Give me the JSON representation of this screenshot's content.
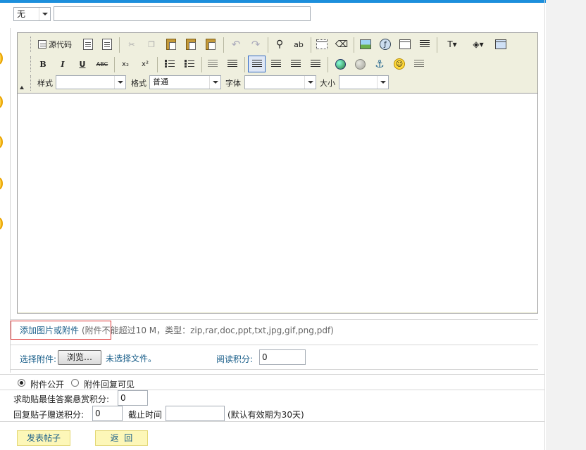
{
  "top": {
    "category_select": "无",
    "title_input": ""
  },
  "toolbar": {
    "source_code": "源代码",
    "bold": "B",
    "italic": "I",
    "underline": "U",
    "strike": "ABC",
    "subscript": "x₂",
    "superscript": "x²",
    "labels": {
      "style": "样式",
      "format": "格式",
      "font": "字体",
      "size": "大小"
    },
    "style_value": "",
    "format_value": "普通",
    "font_value": "",
    "size_value": ""
  },
  "attachment": {
    "add_link": "添加图片或附件",
    "note": "(附件不能超过10 M，类型：zip,rar,doc,ppt,txt,jpg,gif,png,pdf)",
    "choose_label": "选择附件:",
    "browse_button": "浏览…",
    "no_file": "未选择文件。",
    "read_points_label": "阅读积分:",
    "read_points_value": "0"
  },
  "visibility": {
    "public_label": "附件公开",
    "reply_label": "附件回复可见",
    "selected": "public"
  },
  "reward": {
    "best_answer_label": "求助贴最佳答案悬赏积分:",
    "best_answer_value": "0",
    "reply_points_label": "回复贴子赠送积分:",
    "reply_points_value": "0",
    "deadline_label": "截止时间",
    "deadline_value": "",
    "deadline_hint": "(默认有效期为30天)"
  },
  "actions": {
    "submit": "发表帖子",
    "back": "返  回"
  },
  "colors": {
    "accent_bar": "#1c8fdc",
    "link": "#1a5f8a",
    "button_bg": "#fdf7b8",
    "attach_border": "#dd3333"
  }
}
